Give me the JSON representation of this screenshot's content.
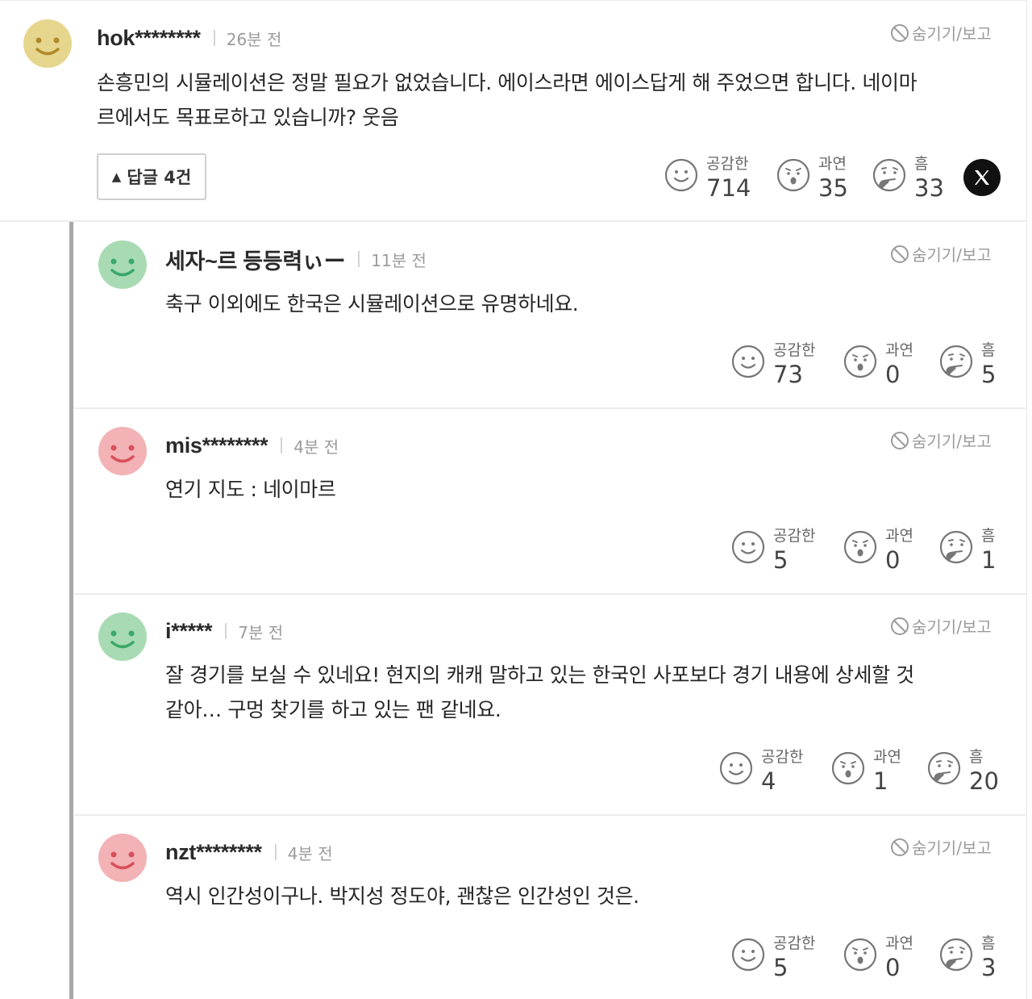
{
  "comment": {
    "author": "hok********",
    "time": "26분 전",
    "hide_report": "숨기기/보고",
    "text_line1": "손흥민의 시뮬레이션은 정말 필요가 없었습니다. 에이스라면 에이스답게 해 주었으면 합니다. 네이마",
    "text_line2": "르에서도 목표로하고 있습니까? 웃음",
    "reply_toggle": "답글 4건",
    "avatar_color": "#e6d68d",
    "reactions": [
      {
        "label": "공감한",
        "count": "714"
      },
      {
        "label": "과연",
        "count": "35"
      },
      {
        "label": "흠",
        "count": "33"
      }
    ]
  },
  "replies": [
    {
      "author": "세자~르 등등력ぃー",
      "time": "11분 전",
      "hide_report": "숨기기/보고",
      "text_line1": "축구 이외에도 한국은 시뮬레이션으로 유명하네요.",
      "text_line2": "",
      "avatar_color": "#a8dbb3",
      "reactions": [
        {
          "label": "공감한",
          "count": "73"
        },
        {
          "label": "과연",
          "count": "0"
        },
        {
          "label": "흠",
          "count": "5"
        }
      ]
    },
    {
      "author": "mis********",
      "time": "4분 전",
      "hide_report": "숨기기/보고",
      "text_line1": "연기 지도 : 네이마르",
      "text_line2": "",
      "avatar_color": "#f3b2b5",
      "reactions": [
        {
          "label": "공감한",
          "count": "5"
        },
        {
          "label": "과연",
          "count": "0"
        },
        {
          "label": "흠",
          "count": "1"
        }
      ]
    },
    {
      "author": "i*****",
      "time": "7분 전",
      "hide_report": "숨기기/보고",
      "text_line1": "잘 경기를 보실 수 있네요! 현지의 캐캐 말하고 있는 한국인 사포보다 경기 내용에 상세할 것",
      "text_line2": "같아… 구멍 찾기를 하고 있는 팬 같네요.",
      "avatar_color": "#a8dbb3",
      "reactions": [
        {
          "label": "공감한",
          "count": "4"
        },
        {
          "label": "과연",
          "count": "1"
        },
        {
          "label": "흠",
          "count": "20"
        }
      ]
    },
    {
      "author": "nzt********",
      "time": "4분 전",
      "hide_report": "숨기기/보고",
      "text_line1": "역시 인간성이구나. 박지성 정도야, 괜찮은 인간성인 것은.",
      "text_line2": "",
      "avatar_color": "#f3b2b5",
      "reactions": [
        {
          "label": "공감한",
          "count": "5"
        },
        {
          "label": "과연",
          "count": "0"
        },
        {
          "label": "흠",
          "count": "3"
        }
      ]
    }
  ],
  "icons": {
    "empathy": "smile-face-icon",
    "indeed": "surprised-face-icon",
    "hmm": "thinking-face-icon",
    "hide": "prohibited-icon",
    "share": "x-logo-icon",
    "toggle": "triangle-up-icon"
  }
}
